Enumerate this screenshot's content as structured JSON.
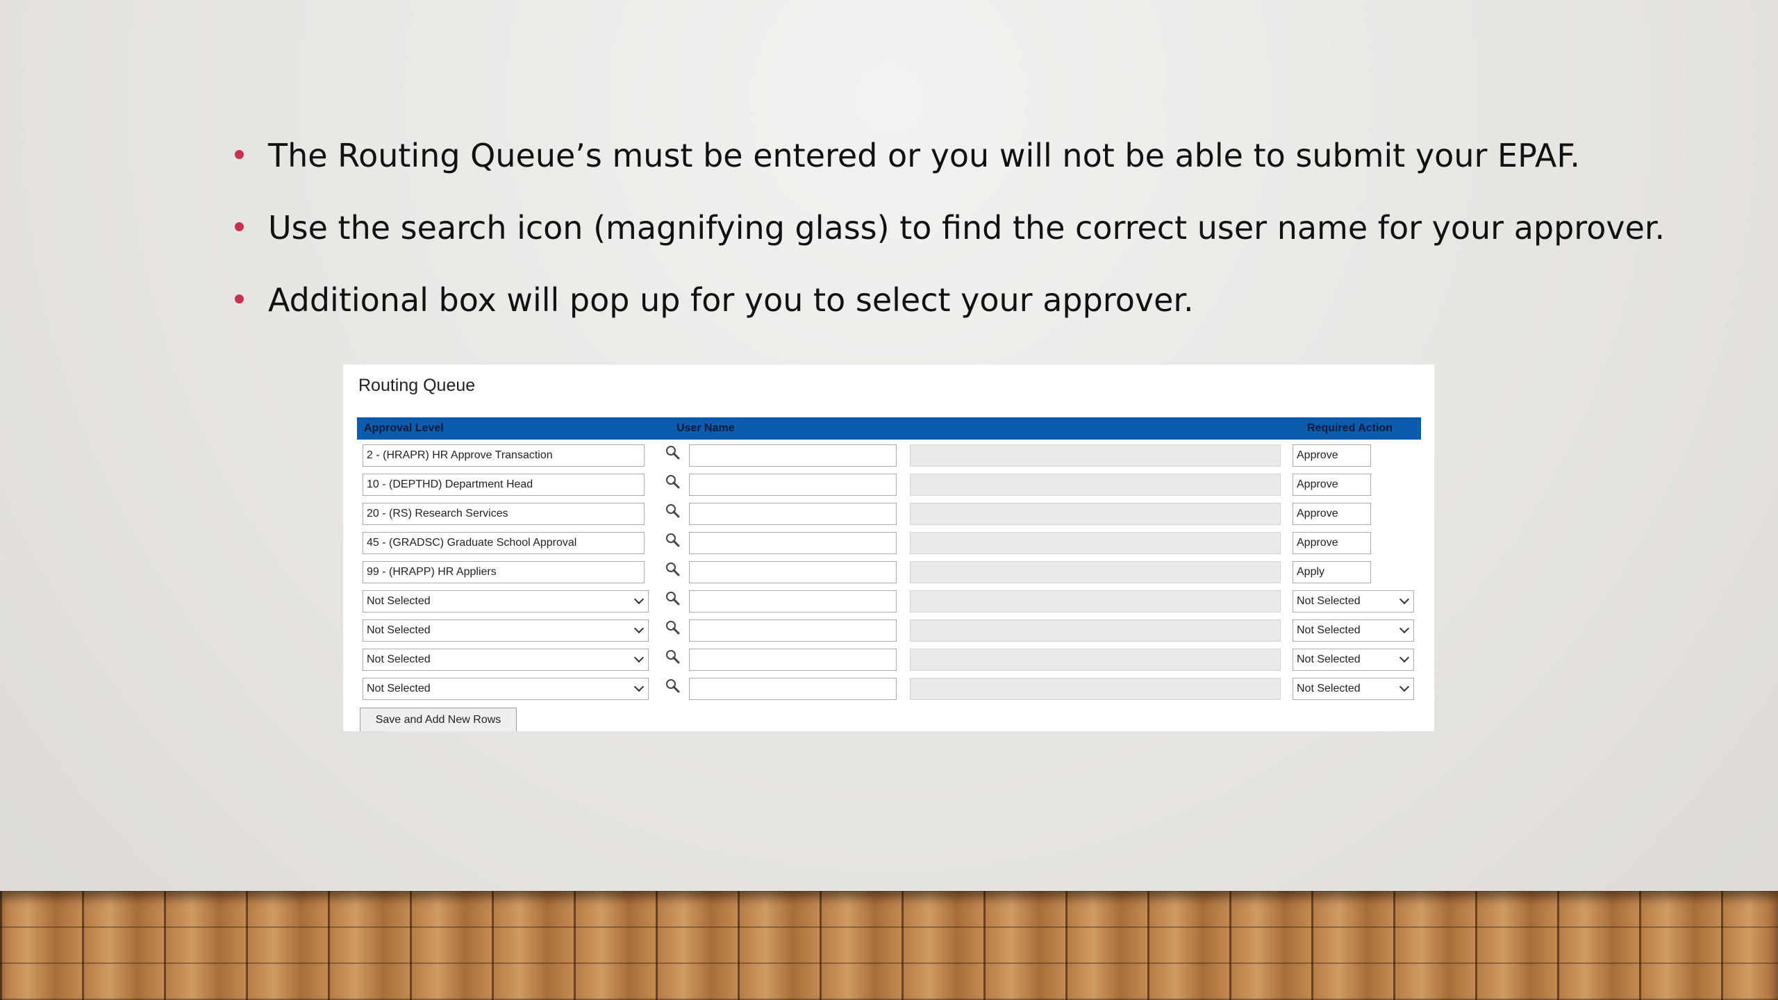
{
  "slide": {
    "bullets": [
      "The Routing Queue’s must be entered or you will not be able to submit your EPAF.",
      "Use the search icon (magnifying glass) to find the correct user name for your approver.",
      "Additional box will pop up for you to select your approver."
    ]
  },
  "routing_queue": {
    "title": "Routing Queue",
    "columns": {
      "approval_level": "Approval Level",
      "user_name": "User Name",
      "required_action": "Required Action"
    },
    "rows": [
      {
        "level": "2 - (HRAPR) HR Approve Transaction",
        "action": "Approve"
      },
      {
        "level": "10 - (DEPTHD) Department Head",
        "action": "Approve"
      },
      {
        "level": "20 - (RS) Research Services",
        "action": "Approve"
      },
      {
        "level": "45 - (GRADSC) Graduate School Approval",
        "action": "Approve"
      },
      {
        "level": "99 - (HRAPP) HR Appliers",
        "action": "Apply"
      },
      {
        "level": "Not Selected",
        "action": "Not Selected"
      },
      {
        "level": "Not Selected",
        "action": "Not Selected"
      },
      {
        "level": "Not Selected",
        "action": "Not Selected"
      },
      {
        "level": "Not Selected",
        "action": "Not Selected"
      }
    ],
    "save_button": "Save and Add New Rows"
  },
  "icons": {
    "bullet": "bullet-dot-icon",
    "search": "magnifying-glass-icon",
    "dropdown": "chevron-down-icon"
  },
  "colors": {
    "header_bar": "#0b5cad",
    "bullet_dot": "#c8304f"
  }
}
